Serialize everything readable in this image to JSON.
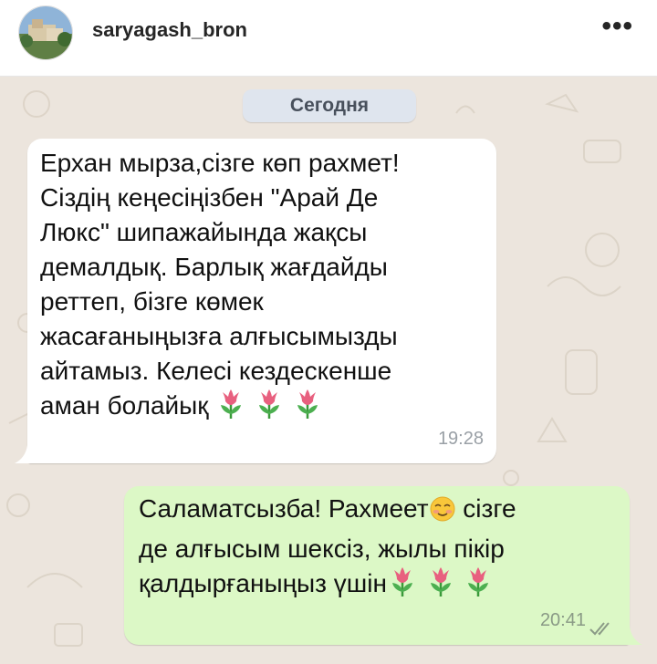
{
  "header": {
    "username": "saryagash_bron",
    "more_label": "•••"
  },
  "chat": {
    "date_label": "Сегодня",
    "messages": [
      {
        "direction": "incoming",
        "text": "Ерхан мырза,сізге көп рахмет!\nСіздің кеңесіңізбен  \"Арай Де\nЛюкс\" шипажайында жақсы\nдемалдық. Барлық жағдайды\nреттеп, бізге көмек\nжасағаныңызға алғысымызды\nайтамыз. Келесі кездескенше\nаман болайық",
        "trailing_emoji": [
          "tulip",
          "tulip",
          "tulip"
        ],
        "time": "19:28"
      },
      {
        "direction": "outgoing",
        "text_part1": "Саламатсызба! Рахмеет",
        "text_part2": " сізге\nде алғысым шексіз, жылы пікір\nқалдырғаныңыз үшін",
        "inline_emoji": "smiling-face",
        "trailing_emoji": [
          "tulip",
          "tulip",
          "tulip"
        ],
        "time": "20:41",
        "status": "read-double-check"
      }
    ]
  },
  "colors": {
    "chat_background": "#ece5dd",
    "incoming_bubble": "#ffffff",
    "outgoing_bubble": "#dcf8c6",
    "date_pill": "#dfe5ee",
    "read_ticks": "#8a9a86"
  }
}
